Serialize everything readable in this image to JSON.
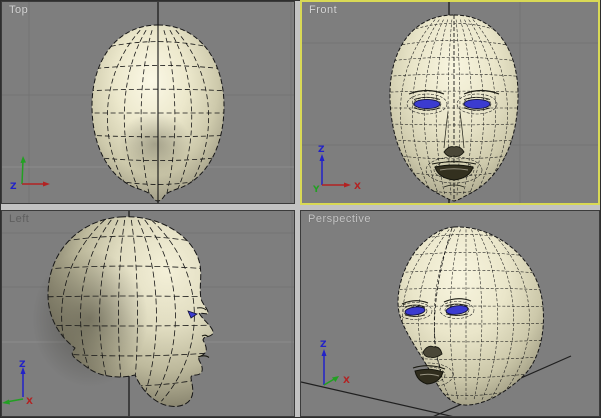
{
  "viewports": {
    "top": {
      "label": "Top",
      "active": false,
      "gizmo": {
        "z": "Z"
      }
    },
    "front": {
      "label": "Front",
      "active": true,
      "gizmo": {
        "z": "Z",
        "x": "X",
        "y": "Y"
      }
    },
    "left": {
      "label": "Left",
      "active": false,
      "gizmo": {
        "z": "Z",
        "x": "X"
      }
    },
    "perspective": {
      "label": "Perspective",
      "active": false,
      "gizmo": {
        "z": "Z",
        "x": "X"
      }
    }
  },
  "scene": {
    "model": "shaded wireframe human head",
    "eye_color": "#3b3bd0"
  },
  "colors": {
    "viewport_background": "#7e7e7e",
    "divider": "#c2c2c2",
    "active_border": "#d9d955",
    "grid_faint": "#747474",
    "grid_light": "#8c8c8c",
    "world_axis_line": "#1c1c1c",
    "wireframe": "#161616",
    "surface_light": "#f7f4de",
    "surface_shadow": "#55524a",
    "axis_x": "#b22222",
    "axis_y": "#22a022",
    "axis_z": "#2222c8",
    "label_text": "#d6d6d6",
    "label_text_dim": "#5f5f5f"
  }
}
